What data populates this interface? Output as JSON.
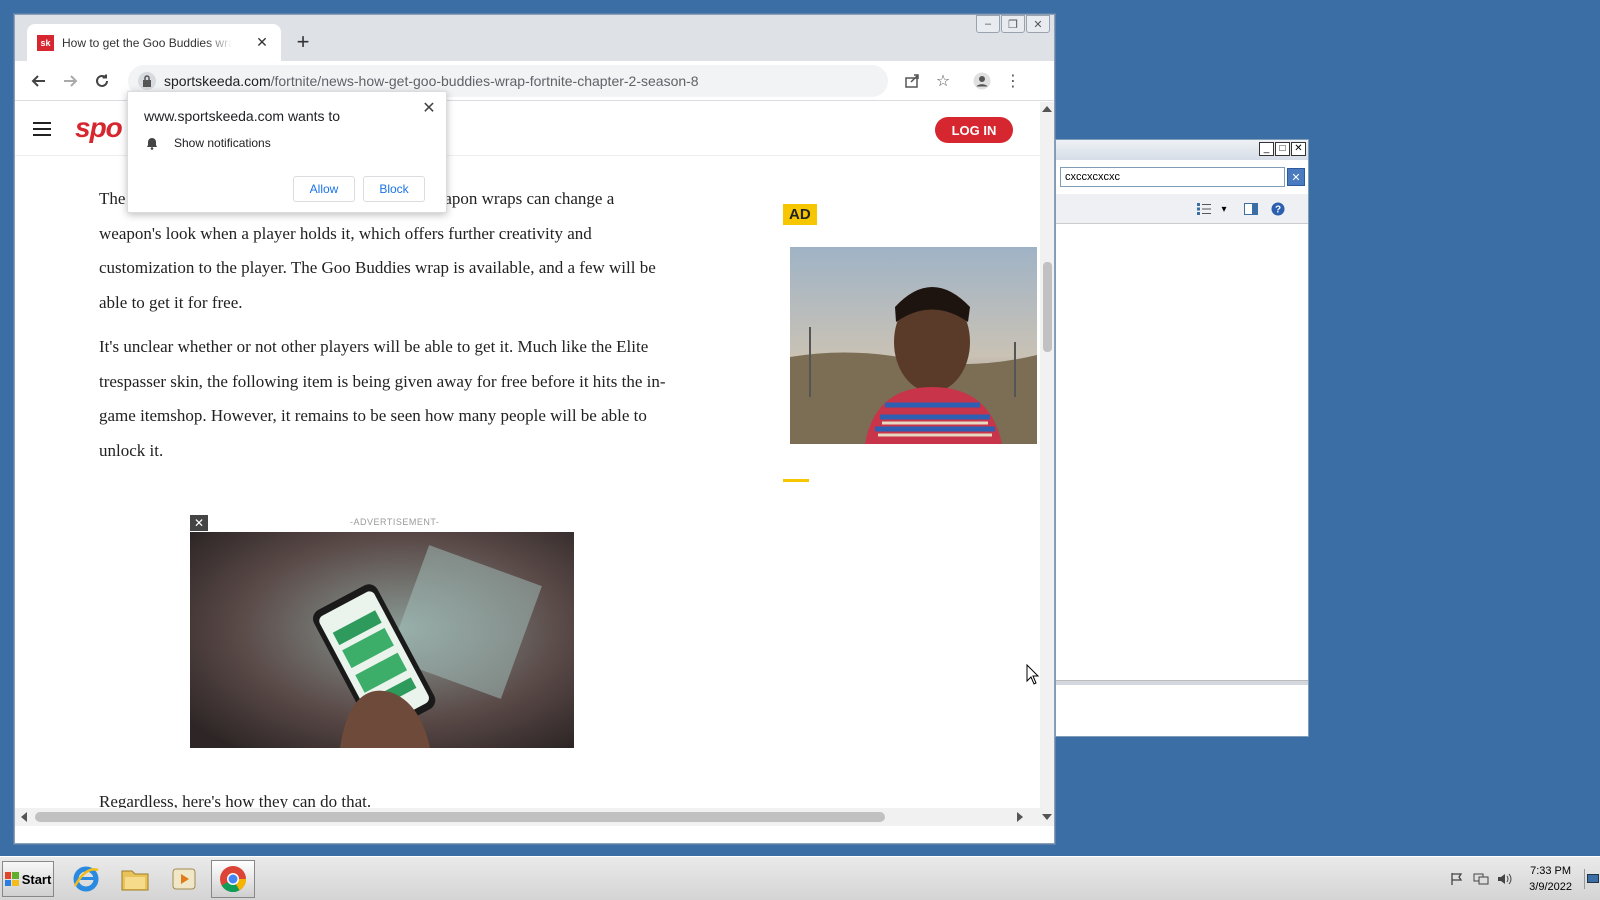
{
  "browser": {
    "tab": {
      "title": "How to get the Goo Buddies wrap in Fortnite",
      "favicon_text": "sk"
    },
    "address": {
      "host": "sportskeeda.com",
      "path": "/fortnite/news-how-get-goo-buddies-wrap-fortnite-chapter-2-season-8"
    }
  },
  "site": {
    "logo_text": "spo",
    "login_label": "LOG IN",
    "brand_color": "#d6262f"
  },
  "article": {
    "p1": "The Goo Buddies wrap is available in Fortnite. Weapon wraps can change a weapon's look when a player holds it, which offers further creativity and customization to the player. The Goo Buddies wrap is available, and a few will be able to get it for free.",
    "p2": "It's unclear whether or not other players will be able to get it. Much like the Elite trespasser skin, the following item is being given away for free before it hits the in-game itemshop. However, it remains to be seen how many people will be able to unlock it.",
    "p3": "Regardless, here's how they can do that."
  },
  "ads": {
    "side_badge": "AD",
    "inline_label": "-ADVERTISEMENT-",
    "close_glyph": "✕"
  },
  "permission_popup": {
    "title": "www.sportskeeda.com wants to",
    "request": "Show notifications",
    "allow": "Allow",
    "block": "Block"
  },
  "side_window": {
    "search_value": "cxccxcxcxc"
  },
  "taskbar": {
    "start_label": "Start",
    "time": "7:33 PM",
    "date": "3/9/2022"
  }
}
